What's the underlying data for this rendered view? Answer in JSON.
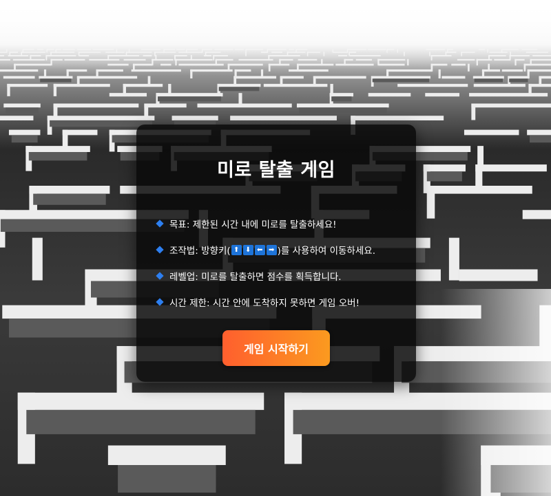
{
  "game": {
    "title": "미로 탈출 게임",
    "rules": [
      {
        "label": "목표",
        "text": " : 제한된 시간 내에 미로를 탈출하세요!"
      },
      {
        "label": "조작법",
        "prefix": " : 방향키(",
        "keys": [
          "⬆",
          "⬇",
          "⬅",
          "➡"
        ],
        "suffix": ")를 사용하여 이동하세요."
      },
      {
        "label": "레벨업",
        "text": " : 미로를 탈출하면 점수를 획득합니다."
      },
      {
        "label": "시간 제한",
        "text": " : 시간 안에 도착하지 못하면 게임 오버!"
      }
    ],
    "start_button": "게임 시작하기"
  },
  "colors": {
    "bullet": "#2d7ff0",
    "key_bg": "#1e74d9",
    "button_gradient_start": "#ff5f2e",
    "button_gradient_end": "#fb9a1f",
    "panel_bg": "rgba(8,8,8,0.84)"
  },
  "icons": {
    "bullet": "blue-diamond-icon",
    "arrow_keys": [
      "arrow-up-icon",
      "arrow-down-icon",
      "arrow-left-icon",
      "arrow-right-icon"
    ]
  }
}
